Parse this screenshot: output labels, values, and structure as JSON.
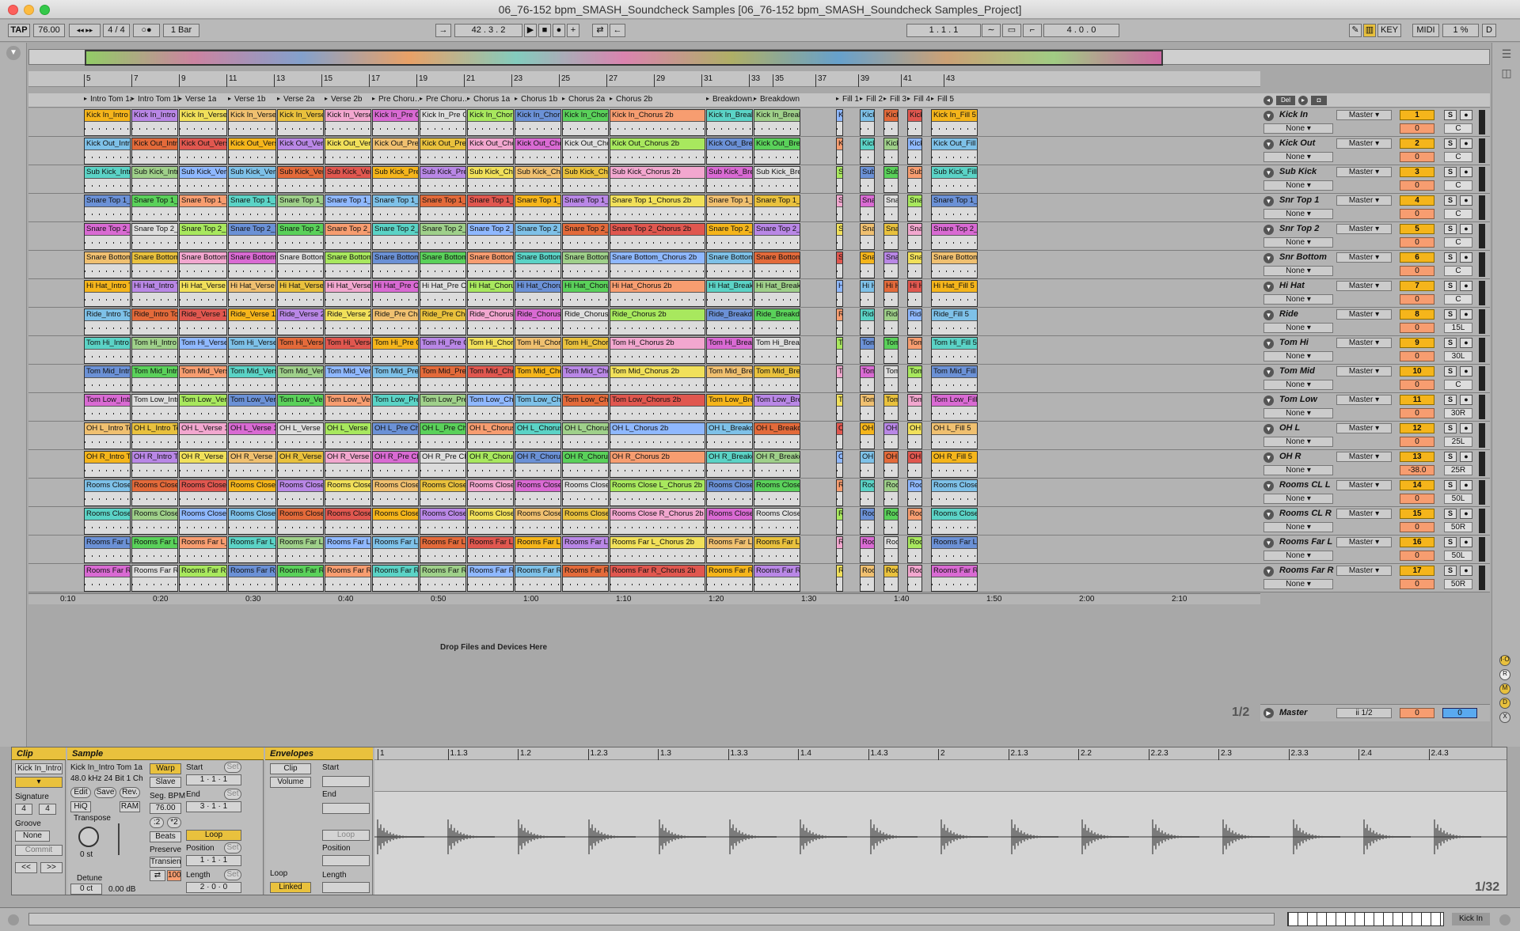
{
  "window": {
    "title": "06_76-152 bpm_SMASH_Soundcheck Samples  [06_76-152 bpm_SMASH_Soundcheck Samples_Project]"
  },
  "control_bar": {
    "tap": "TAP",
    "tempo": "76.00",
    "signature": "4 / 4",
    "quantize": "1 Bar",
    "position": "42 . 3 . 2",
    "loop_start": "1 . 1 . 1",
    "loop_length": "4 . 0 . 0",
    "key": "KEY",
    "midi": "MIDI",
    "cpu": "1 %",
    "d": "D"
  },
  "ruler_bars": [
    "5",
    "7",
    "9",
    "11",
    "13",
    "15",
    "17",
    "19",
    "21",
    "23",
    "25",
    "27",
    "29",
    "31",
    "33",
    "35",
    "37",
    "39",
    "41",
    "43"
  ],
  "locators": [
    "Intro Tom 1a",
    "Intro Tom 1b",
    "Verse 1a",
    "Verse 1b",
    "Verse 2a",
    "Verse 2b",
    "Pre Choru…",
    "Pre Choru…",
    "Chorus 1a",
    "Chorus 1b",
    "Chorus 2a",
    "Chorus 2b",
    "Breakdown…",
    "Breakdown 1b",
    "Fill 1",
    "Fill 2",
    "Fill 3",
    "Fill 4",
    "Fill 5"
  ],
  "tracks": [
    {
      "name": "Kick In",
      "num": "1",
      "vol": "0",
      "pan": "C",
      "out": "Master",
      "inp": "None",
      "clipbase": "Kick In"
    },
    {
      "name": "Kick Out",
      "num": "2",
      "vol": "0",
      "pan": "C",
      "out": "Master",
      "inp": "None",
      "clipbase": "Kick Out"
    },
    {
      "name": "Sub Kick",
      "num": "3",
      "vol": "0",
      "pan": "C",
      "out": "Master",
      "inp": "None",
      "clipbase": "Sub Kick"
    },
    {
      "name": "Snr Top 1",
      "num": "4",
      "vol": "0",
      "pan": "C",
      "out": "Master",
      "inp": "None",
      "clipbase": "Snare Top 1"
    },
    {
      "name": "Snr Top 2",
      "num": "5",
      "vol": "0",
      "pan": "C",
      "out": "Master",
      "inp": "None",
      "clipbase": "Snare Top 2"
    },
    {
      "name": "Snr Bottom",
      "num": "6",
      "vol": "0",
      "pan": "C",
      "out": "Master",
      "inp": "None",
      "clipbase": "Snare Bottom"
    },
    {
      "name": "Hi Hat",
      "num": "7",
      "vol": "0",
      "pan": "C",
      "out": "Master",
      "inp": "None",
      "clipbase": "Hi Hat"
    },
    {
      "name": "Ride",
      "num": "8",
      "vol": "0",
      "pan": "15L",
      "out": "Master",
      "inp": "None",
      "clipbase": "Ride"
    },
    {
      "name": "Tom Hi",
      "num": "9",
      "vol": "0",
      "pan": "30L",
      "out": "Master",
      "inp": "None",
      "clipbase": "Tom Hi"
    },
    {
      "name": "Tom Mid",
      "num": "10",
      "vol": "0",
      "pan": "C",
      "out": "Master",
      "inp": "None",
      "clipbase": "Tom Mid"
    },
    {
      "name": "Tom Low",
      "num": "11",
      "vol": "0",
      "pan": "30R",
      "out": "Master",
      "inp": "None",
      "clipbase": "Tom Low"
    },
    {
      "name": "OH L",
      "num": "12",
      "vol": "0",
      "pan": "25L",
      "out": "Master",
      "inp": "None",
      "clipbase": "OH L"
    },
    {
      "name": "OH R",
      "num": "13",
      "vol": "-38.0",
      "pan": "25R",
      "out": "Master",
      "inp": "None",
      "clipbase": "OH R"
    },
    {
      "name": "Rooms CL L",
      "num": "14",
      "vol": "0",
      "pan": "50L",
      "out": "Master",
      "inp": "None",
      "clipbase": "Rooms Close L"
    },
    {
      "name": "Rooms CL R",
      "num": "15",
      "vol": "0",
      "pan": "50R",
      "out": "Master",
      "inp": "None",
      "clipbase": "Rooms Close R"
    },
    {
      "name": "Rooms Far L",
      "num": "16",
      "vol": "0",
      "pan": "50L",
      "out": "Master",
      "inp": "None",
      "clipbase": "Rooms Far L"
    },
    {
      "name": "Rooms Far R",
      "num": "17",
      "vol": "0",
      "pan": "50R",
      "out": "Master",
      "inp": "None",
      "clipbase": "Rooms Far R"
    }
  ],
  "sections": [
    "Intro Tom 1a",
    "Intro Tom 1b",
    "Verse 1a",
    "Verse 1b",
    "Verse 2a",
    "Verse 2b",
    "Pre Chorus 1a",
    "Pre Chorus 1b",
    "Chorus 1a",
    "Chorus 1b",
    "Chorus 2a",
    "Chorus 2b",
    "Breakdown 1a",
    "Breakdown 1b",
    "Fill 1",
    "Fill 2",
    "Fill 3",
    "Fill 4",
    "Fill 5"
  ],
  "drop_hint": "Drop Files and Devices Here",
  "time_ruler": [
    "0:10",
    "0:20",
    "0:30",
    "0:40",
    "0:50",
    "1:00",
    "1:10",
    "1:20",
    "1:30",
    "1:40",
    "1:50",
    "2:00",
    "2:10"
  ],
  "master": {
    "name": "Master",
    "out": "ii 1/2",
    "vol": "0",
    "num": "0",
    "page": "1/2"
  },
  "clip_panel": {
    "title": "Clip",
    "name": "Kick In_Intro",
    "signature_label": "Signature",
    "sig_num": "4",
    "sig_den": "4",
    "groove_label": "Groove",
    "groove": "None",
    "commit": "Commit"
  },
  "sample_panel": {
    "title": "Sample",
    "file": "Kick In_Intro Tom 1a",
    "format": "48.0 kHz 24 Bit 1 Ch",
    "edit": "Edit",
    "save": "Save",
    "rev": "Rev.",
    "hiq": "HiQ",
    "ram": "RAM",
    "transpose_label": "Transpose",
    "transpose": "0 st",
    "detune_label": "Detune",
    "detune": "0 ct",
    "gain": "0.00 dB",
    "warp": "Warp",
    "slave": "Slave",
    "seg_bpm_label": "Seg. BPM",
    "seg_bpm": "76.00",
    "half": ":2",
    "double": "*2",
    "mode": "Beats",
    "preserve_label": "Preserve",
    "preserve": "Transien",
    "amount": "100",
    "start_label": "Start",
    "end_label": "End",
    "loop": "Loop",
    "position_label": "Position",
    "length_label": "Length",
    "set": "Set"
  },
  "env_panel": {
    "title": "Envelopes",
    "sel1": "Clip",
    "sel2": "Volume",
    "loop_label": "Loop",
    "linked": "Linked",
    "start_label": "Start",
    "end_label": "End",
    "loop": "Loop",
    "position_label": "Position",
    "length_label": "Length"
  },
  "sample_ruler": [
    "1",
    "1.1.3",
    "1.2",
    "1.2.3",
    "1.3",
    "1.3.3",
    "1.4",
    "1.4.3",
    "2",
    "2.1.3",
    "2.2",
    "2.2.3",
    "2.3",
    "2.3.3",
    "2.4",
    "2.4.3"
  ],
  "zoom_page": "1/32",
  "status": {
    "track": "Kick In"
  },
  "colors": {
    "accent": "#e9c13d",
    "number": "#f5b51b",
    "volume": "#f79d70"
  }
}
